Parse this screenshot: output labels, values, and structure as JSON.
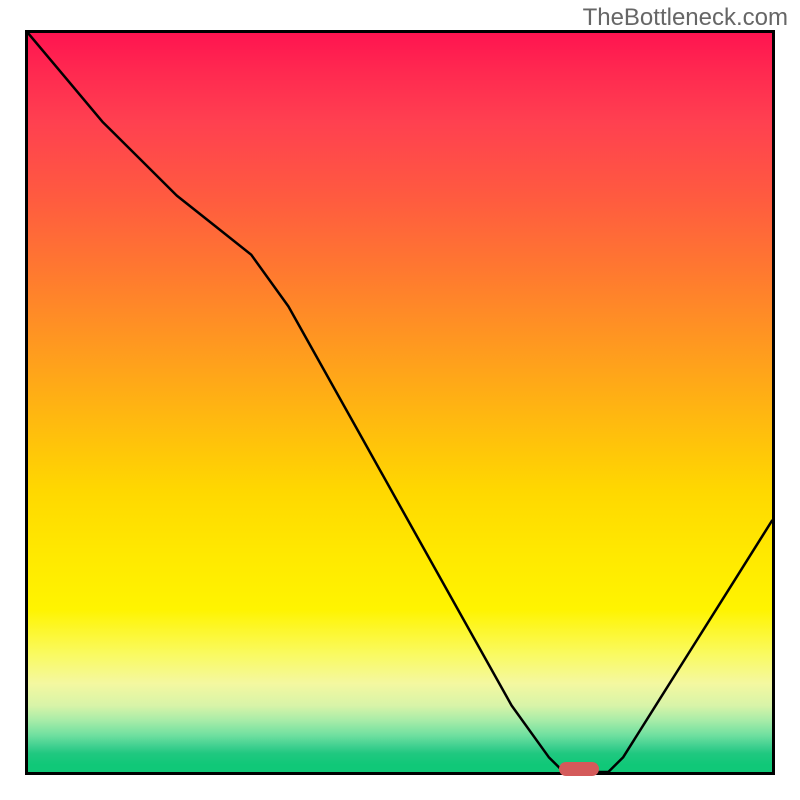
{
  "watermark": "TheBottleneck.com",
  "chart_data": {
    "type": "line",
    "title": "",
    "xlabel": "",
    "ylabel": "",
    "x": [
      0,
      5,
      10,
      15,
      20,
      25,
      30,
      35,
      40,
      45,
      50,
      55,
      60,
      65,
      70,
      72,
      75,
      78,
      80,
      85,
      90,
      95,
      100
    ],
    "values": [
      100,
      94,
      88,
      83,
      78,
      74,
      70,
      63,
      54,
      45,
      36,
      27,
      18,
      9,
      2,
      0,
      0,
      0,
      2,
      10,
      18,
      26,
      34
    ],
    "xlim": [
      0,
      100
    ],
    "ylim": [
      0,
      100
    ],
    "marker": {
      "x": 74,
      "y": 0
    },
    "gradient": {
      "top_color": "#ff1450",
      "mid_color": "#ffd800",
      "bottom_color": "#10c878"
    }
  }
}
